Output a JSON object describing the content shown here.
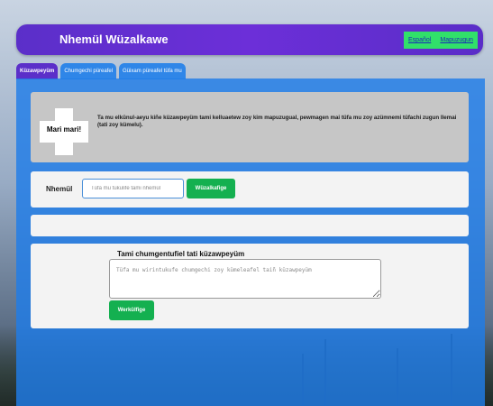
{
  "header": {
    "title": "Nhemül Wüzalkawe",
    "languages": [
      "Español",
      "Mapuzugun"
    ]
  },
  "tabs": [
    {
      "label": "Küzawpeyüm",
      "active": true
    },
    {
      "label": "Chumgechi püreafel",
      "active": false
    },
    {
      "label": "Güixam püreafel tüfa mu",
      "active": false
    }
  ],
  "welcome": {
    "badge": "Mari mari!",
    "text": "Ta mu elkünul-aeyu kiñe küzawpeyüm tami kelluaetew zoy kim mapuzugual, pewmagen mai tüfa mu zoy azümnemi tüfachi zugun llemai (tati zoy kümelu)."
  },
  "name_form": {
    "label": "Nhemül",
    "placeholder": "Tüfa mu tukulife tami nhemül",
    "value": "",
    "button": "Wüzalkafige"
  },
  "output": {
    "text": ""
  },
  "comment": {
    "title": "Tami chumgentufiel tati küzawpeyüm",
    "placeholder": "Tüfa mu wirintukufe chumgechi zoy kümeleafel taiñ küzawpeyüm",
    "button": "Werkülfige"
  },
  "colors": {
    "header": "#5b2fc9",
    "panel": "#2f86e8",
    "button": "#14b050",
    "lang_box": "#31e06a"
  }
}
